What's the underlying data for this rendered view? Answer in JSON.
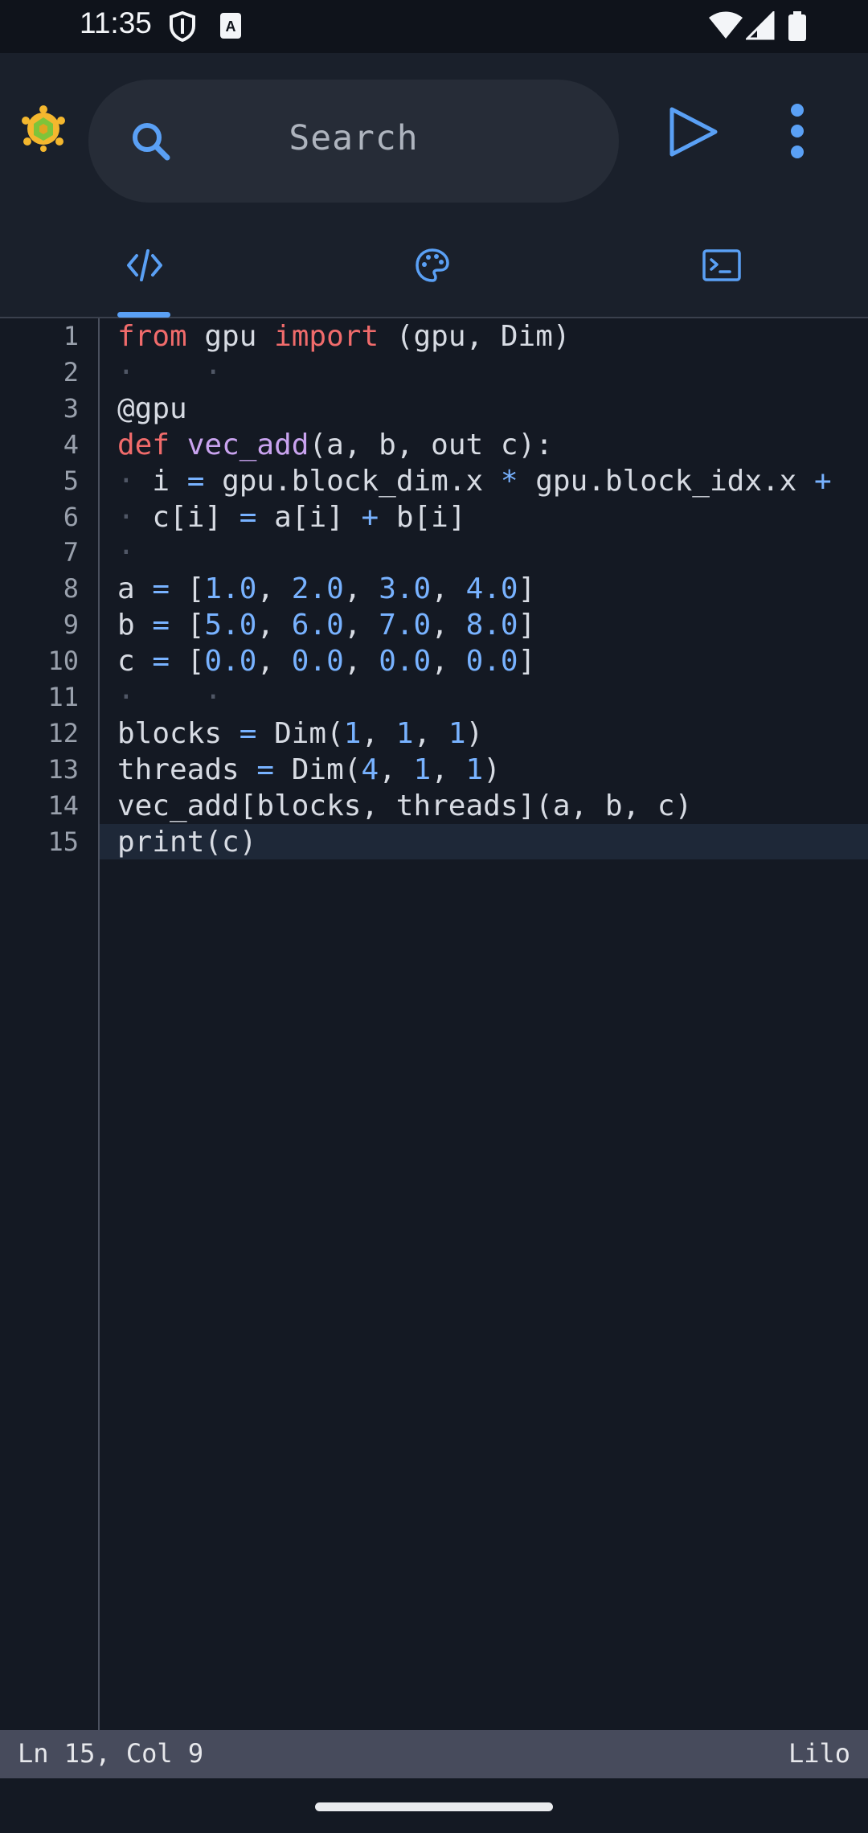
{
  "status_bar": {
    "time": "11:35",
    "icons": [
      "shield-icon",
      "keyboard-a-icon",
      "wifi-icon",
      "signal-icon",
      "battery-icon"
    ]
  },
  "toolbar": {
    "logo": "turtle-logo-icon",
    "search_placeholder": "Search",
    "run": "play-icon",
    "menu": "more-vert-icon"
  },
  "tabs": [
    {
      "icon": "code-icon",
      "selected": true
    },
    {
      "icon": "palette-icon",
      "selected": false
    },
    {
      "icon": "terminal-icon",
      "selected": false
    }
  ],
  "editor": {
    "line_numbers": [
      "1",
      "2",
      "3",
      "4",
      "5",
      "6",
      "7",
      "8",
      "9",
      "10",
      "11",
      "12",
      "13",
      "14",
      "15"
    ],
    "current_line": 15,
    "lines": [
      [
        {
          "t": "from",
          "c": "kw"
        },
        {
          "t": " gpu "
        },
        {
          "t": "import",
          "c": "kw"
        },
        {
          "t": " (gpu, Dim)"
        }
      ],
      [
        {
          "t": "·    ·",
          "c": "ws"
        }
      ],
      [
        {
          "t": "@gpu"
        }
      ],
      [
        {
          "t": "def",
          "c": "kw"
        },
        {
          "t": " "
        },
        {
          "t": "vec_add",
          "c": "fn"
        },
        {
          "t": "(a, b, out c):"
        }
      ],
      [
        {
          "t": "·",
          "c": "ws"
        },
        {
          "t": " i "
        },
        {
          "t": "=",
          "c": "op"
        },
        {
          "t": " gpu.block_dim.x "
        },
        {
          "t": "*",
          "c": "op"
        },
        {
          "t": " gpu.block_idx.x "
        },
        {
          "t": "+",
          "c": "op"
        }
      ],
      [
        {
          "t": "·",
          "c": "ws"
        },
        {
          "t": " c[i] "
        },
        {
          "t": "=",
          "c": "op"
        },
        {
          "t": " a[i] "
        },
        {
          "t": "+",
          "c": "op"
        },
        {
          "t": " b[i]"
        }
      ],
      [
        {
          "t": "·",
          "c": "ws"
        }
      ],
      [
        {
          "t": "a "
        },
        {
          "t": "=",
          "c": "op"
        },
        {
          "t": " ["
        },
        {
          "t": "1.0",
          "c": "num"
        },
        {
          "t": ", "
        },
        {
          "t": "2.0",
          "c": "num"
        },
        {
          "t": ", "
        },
        {
          "t": "3.0",
          "c": "num"
        },
        {
          "t": ", "
        },
        {
          "t": "4.0",
          "c": "num"
        },
        {
          "t": "]"
        }
      ],
      [
        {
          "t": "b "
        },
        {
          "t": "=",
          "c": "op"
        },
        {
          "t": " ["
        },
        {
          "t": "5.0",
          "c": "num"
        },
        {
          "t": ", "
        },
        {
          "t": "6.0",
          "c": "num"
        },
        {
          "t": ", "
        },
        {
          "t": "7.0",
          "c": "num"
        },
        {
          "t": ", "
        },
        {
          "t": "8.0",
          "c": "num"
        },
        {
          "t": "]"
        }
      ],
      [
        {
          "t": "c "
        },
        {
          "t": "=",
          "c": "op"
        },
        {
          "t": " ["
        },
        {
          "t": "0.0",
          "c": "num"
        },
        {
          "t": ", "
        },
        {
          "t": "0.0",
          "c": "num"
        },
        {
          "t": ", "
        },
        {
          "t": "0.0",
          "c": "num"
        },
        {
          "t": ", "
        },
        {
          "t": "0.0",
          "c": "num"
        },
        {
          "t": "]"
        }
      ],
      [
        {
          "t": "·    ·",
          "c": "ws"
        }
      ],
      [
        {
          "t": "blocks "
        },
        {
          "t": "=",
          "c": "op"
        },
        {
          "t": " Dim("
        },
        {
          "t": "1",
          "c": "num"
        },
        {
          "t": ", "
        },
        {
          "t": "1",
          "c": "num"
        },
        {
          "t": ", "
        },
        {
          "t": "1",
          "c": "num"
        },
        {
          "t": ")"
        }
      ],
      [
        {
          "t": "threads "
        },
        {
          "t": "=",
          "c": "op"
        },
        {
          "t": " Dim("
        },
        {
          "t": "4",
          "c": "num"
        },
        {
          "t": ", "
        },
        {
          "t": "1",
          "c": "num"
        },
        {
          "t": ", "
        },
        {
          "t": "1",
          "c": "num"
        },
        {
          "t": ")"
        }
      ],
      [
        {
          "t": "vec_add[blocks, threads](a, b, c)"
        }
      ],
      [
        {
          "t": "print(c)"
        }
      ]
    ]
  },
  "status_line": {
    "cursor": "Ln 15, Col 9",
    "language": "Lilo"
  }
}
